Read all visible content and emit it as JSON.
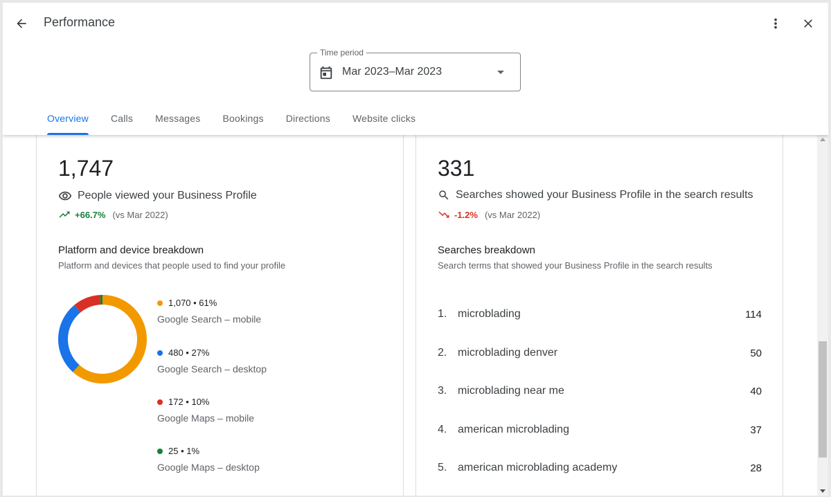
{
  "header": {
    "title": "Performance",
    "time_period": {
      "label": "Time period",
      "value": "Mar 2023–Mar 2023"
    },
    "tabs": [
      {
        "label": "Overview",
        "active": true
      },
      {
        "label": "Calls"
      },
      {
        "label": "Messages"
      },
      {
        "label": "Bookings"
      },
      {
        "label": "Directions"
      },
      {
        "label": "Website clicks"
      }
    ]
  },
  "views": {
    "count": "1,747",
    "label": "People viewed your Business Profile",
    "delta": "+66.7%",
    "compare": "(vs Mar 2022)",
    "breakdown_title": "Platform and device breakdown",
    "breakdown_subtitle": "Platform and devices that people used to find your profile",
    "legend": [
      {
        "value": "1,070 • 61%",
        "name": "Google Search – mobile",
        "color": "#f29900",
        "share": 61
      },
      {
        "value": "480 • 27%",
        "name": "Google Search – desktop",
        "color": "#1a73e8",
        "share": 27
      },
      {
        "value": "172 • 10%",
        "name": "Google Maps – mobile",
        "color": "#d93025",
        "share": 10
      },
      {
        "value": "25 • 1%",
        "name": "Google Maps – desktop",
        "color": "#188038",
        "share": 1
      }
    ]
  },
  "searches": {
    "count": "331",
    "label": "Searches showed your Business Profile in the search results",
    "delta": "-1.2%",
    "compare": "(vs Mar 2022)",
    "breakdown_title": "Searches breakdown",
    "breakdown_subtitle": "Search terms that showed your Business Profile in the search results",
    "terms": [
      {
        "rank": "1.",
        "term": "microblading",
        "count": "114"
      },
      {
        "rank": "2.",
        "term": "microblading denver",
        "count": "50"
      },
      {
        "rank": "3.",
        "term": "microblading near me",
        "count": "40"
      },
      {
        "rank": "4.",
        "term": "american microblading",
        "count": "37"
      },
      {
        "rank": "5.",
        "term": "american microblading academy",
        "count": "28"
      }
    ]
  },
  "colors": {
    "accent": "#1a73e8",
    "positive": "#188038",
    "negative": "#d93025"
  },
  "icons": {
    "back": "arrow-back-icon",
    "more": "more-vert-icon",
    "close": "close-icon",
    "calendar": "calendar-icon",
    "views": "eye-icon",
    "search": "search-icon",
    "trend_up": "trending-up-icon",
    "trend_down": "trending-down-icon"
  }
}
